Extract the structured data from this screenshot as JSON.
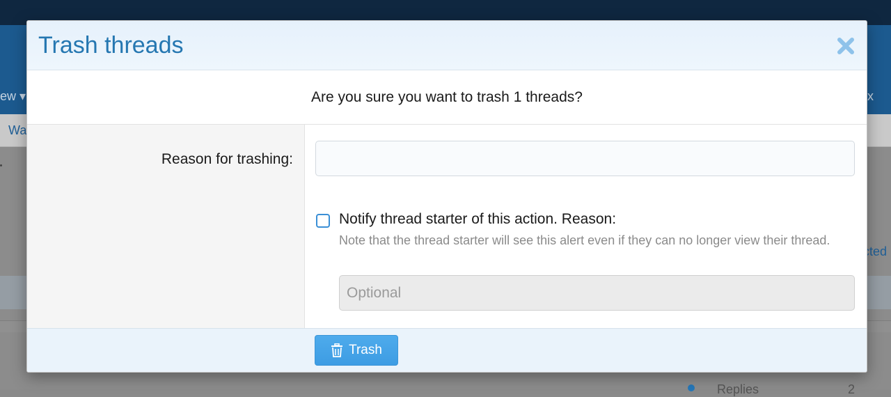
{
  "background": {
    "nav_left_text": "ew ▾",
    "nav_right_text": "x",
    "subnav_left_text": "Wa",
    "right_link_text": "cted",
    "bottom_text": "Replies",
    "bottom_number": "2"
  },
  "modal": {
    "title": "Trash threads",
    "confirm_message": "Are you sure you want to trash 1 threads?",
    "reason_label": "Reason for trashing:",
    "reason_value": "",
    "notify_label": "Notify thread starter of this action. Reason:",
    "notify_checked": false,
    "notify_hint": "Note that the thread starter will see this alert even if they can no longer view their thread.",
    "optional_placeholder": "Optional",
    "trash_button_label": "Trash"
  },
  "icons": {
    "close": "close-icon",
    "trash": "trash-icon"
  },
  "colors": {
    "accent": "#2577b1",
    "button": "#47a5e8",
    "close_icon": "#8ec2ea"
  }
}
